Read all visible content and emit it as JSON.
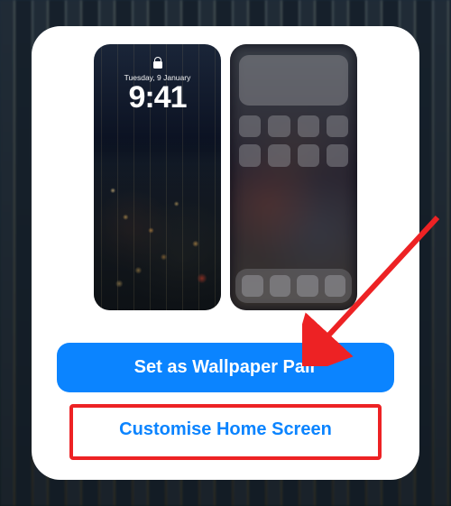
{
  "lockScreen": {
    "date": "Tuesday, 9 January",
    "time": "9:41"
  },
  "buttons": {
    "primary": "Set as Wallpaper Pair",
    "secondary": "Customise Home Screen"
  },
  "colors": {
    "accent": "#0b84ff",
    "highlight": "#ed2224"
  }
}
